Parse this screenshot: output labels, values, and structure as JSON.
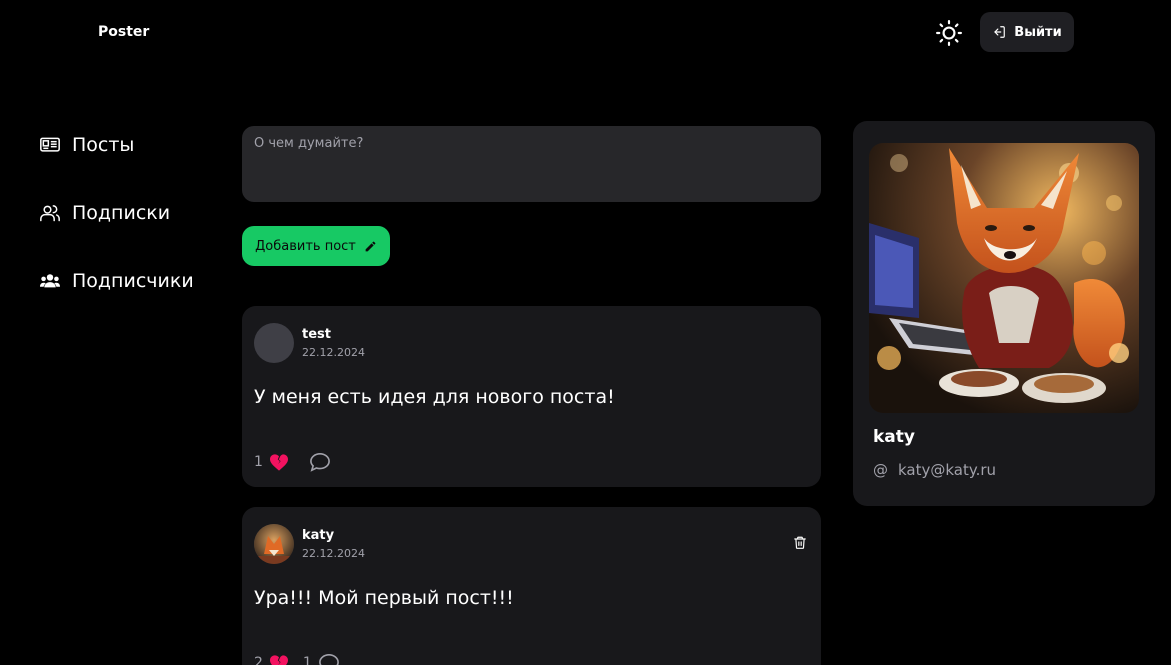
{
  "header": {
    "logo": "Poster",
    "logout_label": "Выйти"
  },
  "sidebar": {
    "items": [
      {
        "label": "Посты",
        "icon": "newspaper-icon"
      },
      {
        "label": "Подписки",
        "icon": "users-icon"
      },
      {
        "label": "Подписчики",
        "icon": "user-group-icon"
      }
    ]
  },
  "composer": {
    "placeholder": "О чем думайте?",
    "value": "",
    "submit_label": "Добавить пост"
  },
  "posts": [
    {
      "author": "test",
      "date": "22.12.2024",
      "text": "У меня есть идея для нового поста!",
      "likes": "1",
      "comments": "",
      "deletable": false
    },
    {
      "author": "katy",
      "date": "22.12.2024",
      "text": "Ура!!! Мой первый пост!!!",
      "likes": "2",
      "comments": "1",
      "deletable": true
    }
  ],
  "profile": {
    "name": "katy",
    "email": "katy@katy.ru"
  },
  "colors": {
    "accent": "#17c964",
    "background": "#000000",
    "card": "#18181b",
    "like": "#f31260"
  }
}
